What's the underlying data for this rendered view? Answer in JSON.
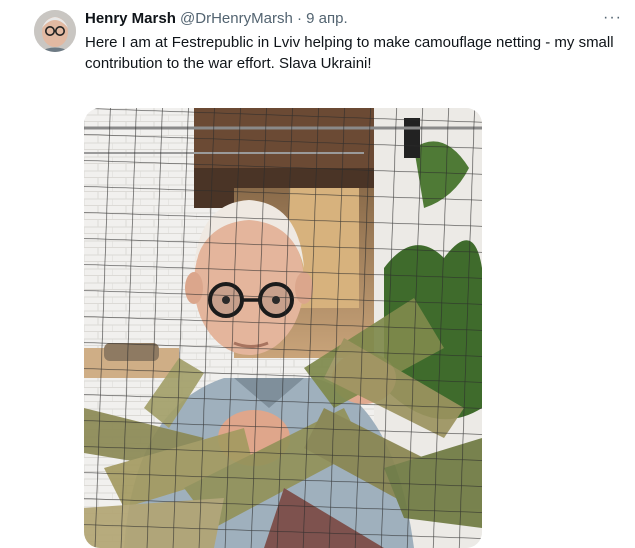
{
  "tweet": {
    "author_name": "Henry Marsh",
    "author_handle": "@DrHenryMarsh",
    "separator": "·",
    "timestamp": "9 апр.",
    "text": "Here I am at Festrepublic in Lviv helping to make camouflage netting  - my small contribution to the war effort. Slava Ukraini!",
    "more_icon": "more-horizontal-icon",
    "more_label": "···"
  },
  "photo": {
    "subject": "elderly man with round glasses weaving camouflage netting"
  },
  "colors": {
    "text_primary": "#0f1419",
    "text_secondary": "#536471",
    "background": "#ffffff"
  }
}
